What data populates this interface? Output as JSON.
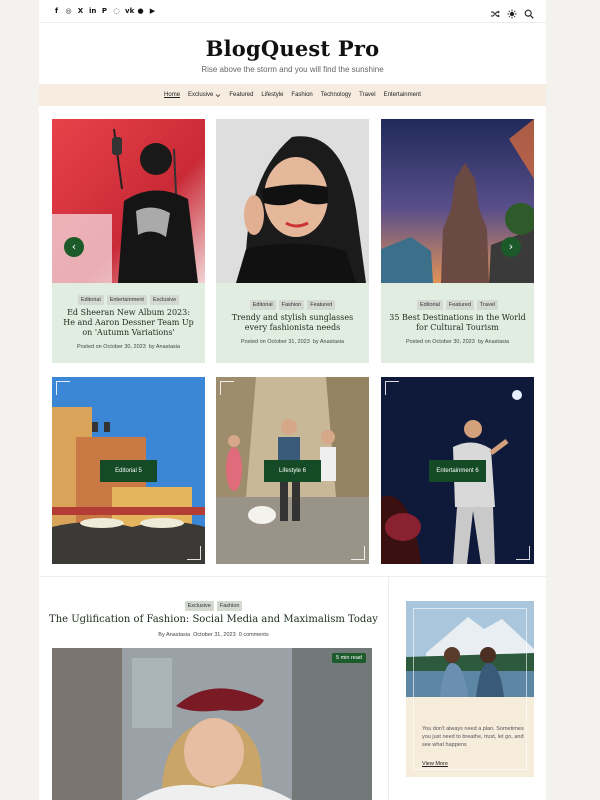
{
  "header": {
    "site_title": "BlogQuest Pro",
    "tagline": "Rise above the storm and you will find the sunshine",
    "socials": [
      "facebook-icon",
      "instagram-icon",
      "x-icon",
      "linkedin-icon",
      "pinterest-icon",
      "whatsapp-icon",
      "vk-icon",
      "spotify-icon",
      "youtube-icon"
    ],
    "tools": [
      "shuffle-icon",
      "sun-icon",
      "search-icon"
    ]
  },
  "nav": {
    "items": [
      "Home",
      "Exclusive",
      "Featured",
      "Lifestyle",
      "Fashion",
      "Technology",
      "Travel",
      "Entertainment"
    ]
  },
  "slider": {
    "prev_arrow": "‹",
    "next_arrow": "›",
    "cards": [
      {
        "tags": [
          "Editorial",
          "Entertainment",
          "Exclusive"
        ],
        "title": "Ed Sheeran New Album 2023: He and Aaron Dessner Team Up on 'Autumn Variations'",
        "posted_on": "Posted on",
        "date": "October 30, 2023",
        "by": "by",
        "author": "Anastasia"
      },
      {
        "tags": [
          "Editorial",
          "Fashion",
          "Featured"
        ],
        "title": "Trendy and stylish sunglasses every fashionista needs",
        "posted_on": "Posted on",
        "date": "October 31, 2023",
        "by": "by",
        "author": "Anastasia"
      },
      {
        "tags": [
          "Editorial",
          "Featured",
          "Travel"
        ],
        "title": "35 Best Destinations in the World for Cultural Tourism",
        "posted_on": "Posted on",
        "date": "October 30, 2023",
        "by": "by",
        "author": "Anastasia"
      }
    ]
  },
  "categories": [
    {
      "label": "Editorial 5"
    },
    {
      "label": "Lifestyle 6"
    },
    {
      "label": "Entertainment 6"
    }
  ],
  "featured_post": {
    "tags": [
      "Exclusive",
      "Fashion"
    ],
    "title": "The Uglification of Fashion: Social Media and Maximalism Today",
    "by": "By",
    "author": "Anastasia",
    "date": "October 31, 2023",
    "comments": "0 comments",
    "read_time": "5 min read"
  },
  "widget": {
    "text": "You don't always need a plan. Sometimes you just need to breathe, trust, let go, and see what happens",
    "link": "View More"
  },
  "colors": {
    "accent": "#1d5a2a",
    "nav_bg": "#f6ecdf",
    "card_bg": "#e2ede2",
    "widget_bg": "#f5ecdc"
  }
}
